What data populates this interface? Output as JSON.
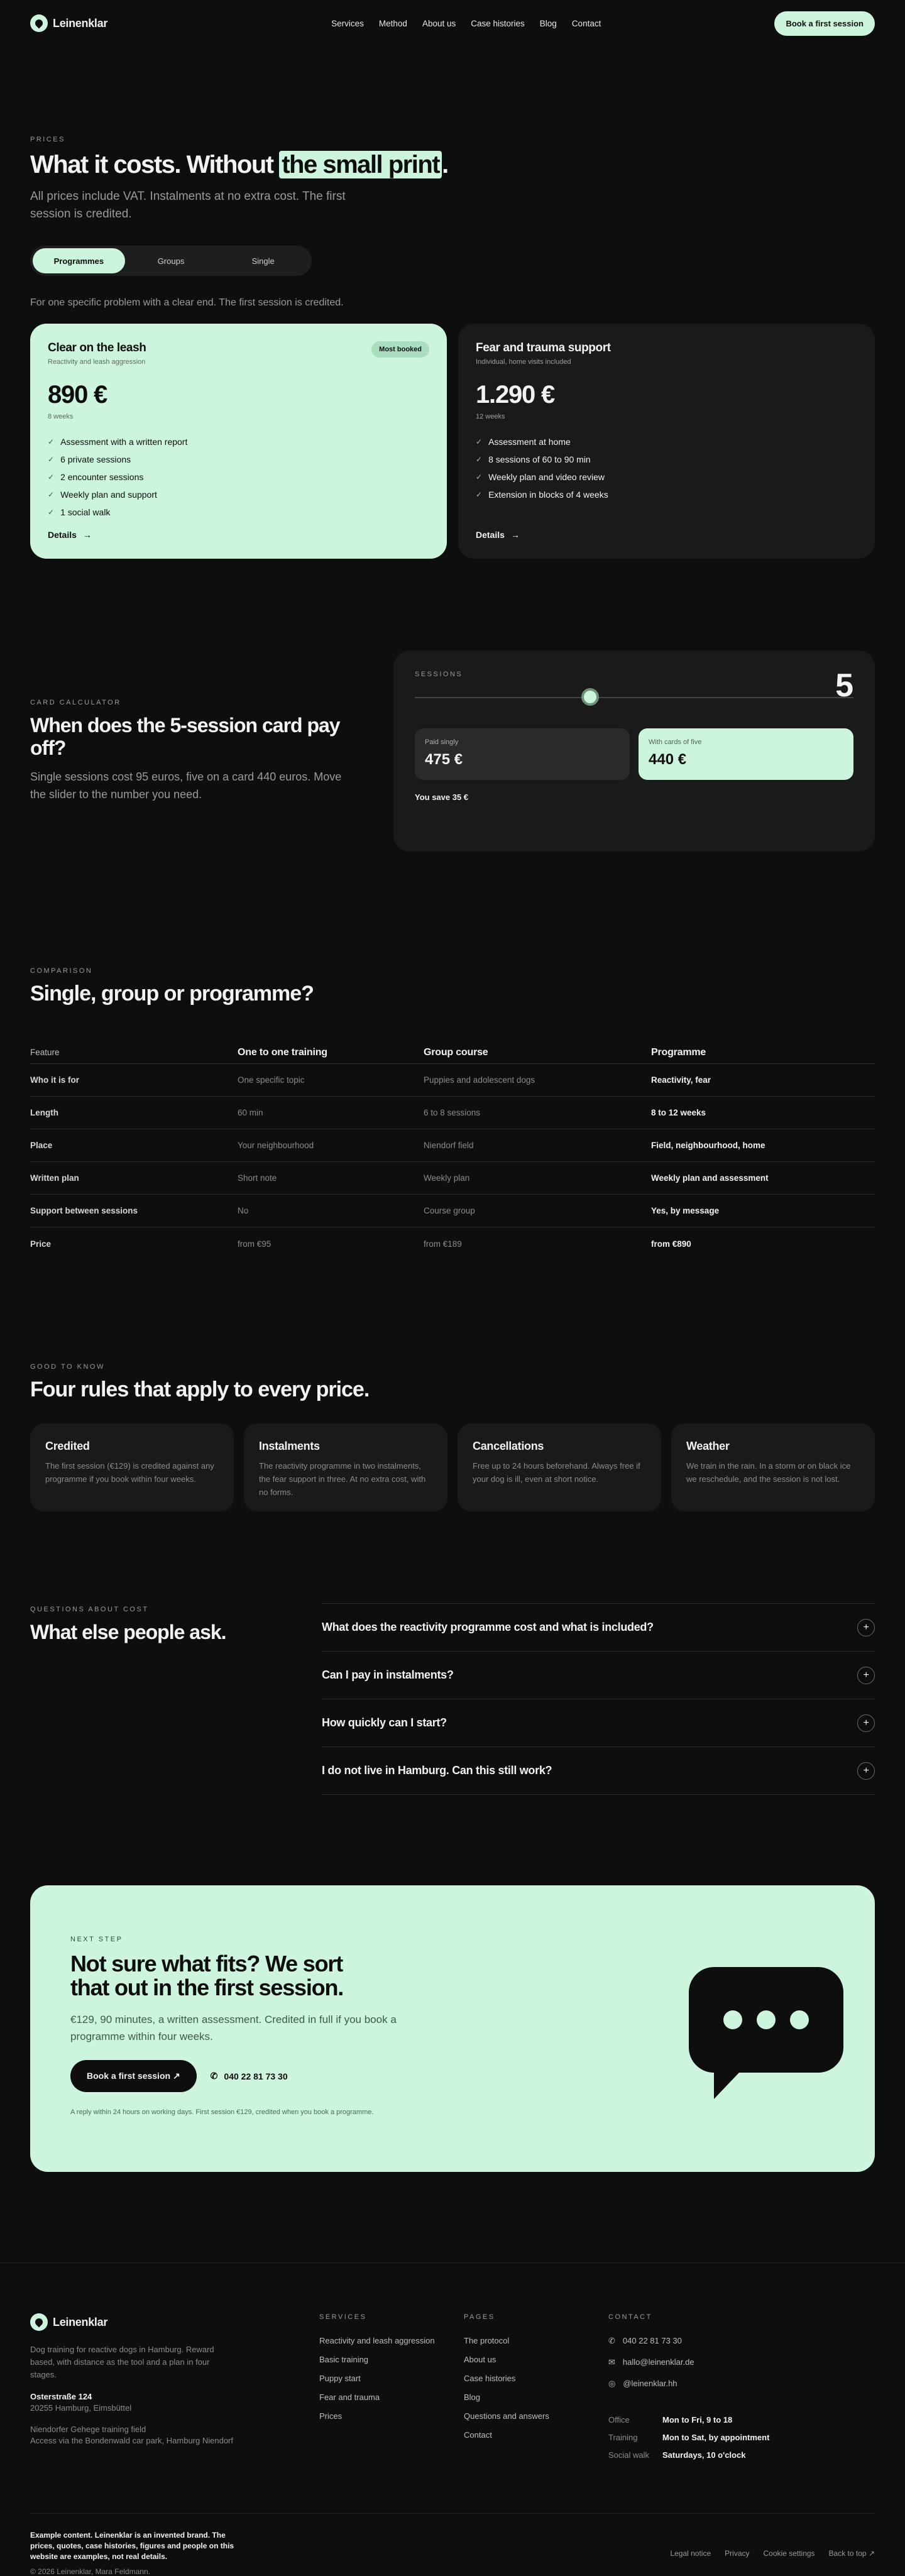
{
  "brand": {
    "name": "Leinenklar"
  },
  "nav": {
    "items": [
      "Services",
      "Method",
      "About us",
      "Case histories",
      "Blog",
      "Contact"
    ],
    "cta": "Book a first session"
  },
  "prices": {
    "eyebrow": "PRICES",
    "title_pre": "What it costs. Without ",
    "title_hl": "the small print",
    "title_post": ".",
    "lead": "All prices include VAT. Instalments at no extra cost. The first session is credited.",
    "tabs": [
      "Programmes",
      "Groups",
      "Single"
    ],
    "active_tab": "Programmes",
    "desc": "For one specific problem with a clear end. The first session is credited.",
    "cards": [
      {
        "title": "Clear on the leash",
        "sub": "Reactivity and leash aggression",
        "price": "890 €",
        "dur": "8 weeks",
        "badge": "Most booked",
        "items": [
          "Assessment with a written report",
          "6 private sessions",
          "2 encounter sessions",
          "Weekly plan and support",
          "1 social walk"
        ],
        "details": "Details"
      },
      {
        "title": "Fear and trauma support",
        "sub": "Individual, home visits included",
        "price": "1.290 €",
        "dur": "12 weeks",
        "items": [
          "Assessment at home",
          "8 sessions of 60 to 90 min",
          "Weekly plan and video review",
          "Extension in blocks of 4 weeks"
        ],
        "details": "Details"
      }
    ]
  },
  "calculator": {
    "eyebrow": "CARD CALCULATOR",
    "title": "When does the 5-session card pay off?",
    "lead": "Single sessions cost 95 euros, five on a card 440 euros. Move the slider to the number you need.",
    "label": "SESSIONS",
    "sessions": "5",
    "slider_fraction": 0.4,
    "paid_single_label": "Paid singly",
    "paid_single_value": "475 €",
    "card_label": "With cards of five",
    "card_value": "440 €",
    "save": "You save 35 €"
  },
  "comparison": {
    "eyebrow": "COMPARISON",
    "title": "Single, group or programme?",
    "headers": [
      "Feature",
      "One to one training",
      "Group course",
      "Programme"
    ],
    "rows": [
      [
        "Who it is for",
        "One specific topic",
        "Puppies and adolescent dogs",
        "Reactivity, fear"
      ],
      [
        "Length",
        "60 min",
        "6 to 8 sessions",
        "8 to 12 weeks"
      ],
      [
        "Place",
        "Your neighbourhood",
        "Niendorf field",
        "Field, neighbourhood, home"
      ],
      [
        "Written plan",
        "Short note",
        "Weekly plan",
        "Weekly plan and assessment"
      ],
      [
        "Support between sessions",
        "No",
        "Course group",
        "Yes, by message"
      ],
      [
        "Price",
        "from €95",
        "from €189",
        "from €890"
      ]
    ]
  },
  "rules": {
    "eyebrow": "GOOD TO KNOW",
    "title": "Four rules that apply to every price.",
    "cards": [
      {
        "title": "Credited",
        "text": "The first session (€129) is credited against any programme if you book within four weeks."
      },
      {
        "title": "Instalments",
        "text": "The reactivity programme in two instalments, the fear support in three. At no extra cost, with no forms."
      },
      {
        "title": "Cancellations",
        "text": "Free up to 24 hours beforehand. Always free if your dog is ill, even at short notice."
      },
      {
        "title": "Weather",
        "text": "We train in the rain. In a storm or on black ice we reschedule, and the session is not lost."
      }
    ]
  },
  "faq": {
    "eyebrow": "QUESTIONS ABOUT COST",
    "title": "What else people ask.",
    "items": [
      "What does the reactivity programme cost and what is included?",
      "Can I pay in instalments?",
      "How quickly can I start?",
      "I do not live in Hamburg. Can this still work?"
    ]
  },
  "cta": {
    "eyebrow": "NEXT STEP",
    "title": "Not sure what fits? We sort that out in the first session.",
    "lead": "€129, 90 minutes, a written assessment. Credited in full if you book a programme within four weeks.",
    "button": "Book a first session",
    "phone": "040 22 81 73 30",
    "note": "A reply within 24 hours on working days. First session €129, credited when you book a programme."
  },
  "footer": {
    "about": "Dog training for reactive dogs in Hamburg. Reward based, with distance as the tool and a plan in four stages.",
    "street": "Osterstraße 124",
    "city": "20255 Hamburg, Eimsbüttel",
    "field1": "Niendorfer Gehege training field",
    "field2": "Access via the Bondenwald car park, Hamburg Niendorf",
    "services_title": "SERVICES",
    "services": [
      "Reactivity and leash aggression",
      "Basic training",
      "Puppy start",
      "Fear and trauma",
      "Prices"
    ],
    "pages_title": "PAGES",
    "pages": [
      "The protocol",
      "About us",
      "Case histories",
      "Blog",
      "Questions and answers",
      "Contact"
    ],
    "contact_title": "CONTACT",
    "phone": "040 22 81 73 30",
    "email": "hallo@leinenklar.de",
    "insta": "@leinenklar.hh",
    "hours": [
      [
        "Office",
        "Mon to Fri, 9 to 18"
      ],
      [
        "Training",
        "Mon to Sat, by appointment"
      ],
      [
        "Social walk",
        "Saturdays, 10 o'clock"
      ]
    ],
    "note": "Example content. Leinenklar is an invented brand. The prices, quotes, case histories, figures and people on this website are examples, not real details.",
    "copy": "© 2026 Leinenklar, Mara Feldmann.",
    "legal": [
      "Legal notice",
      "Privacy",
      "Cookie settings",
      "Back to top"
    ]
  }
}
